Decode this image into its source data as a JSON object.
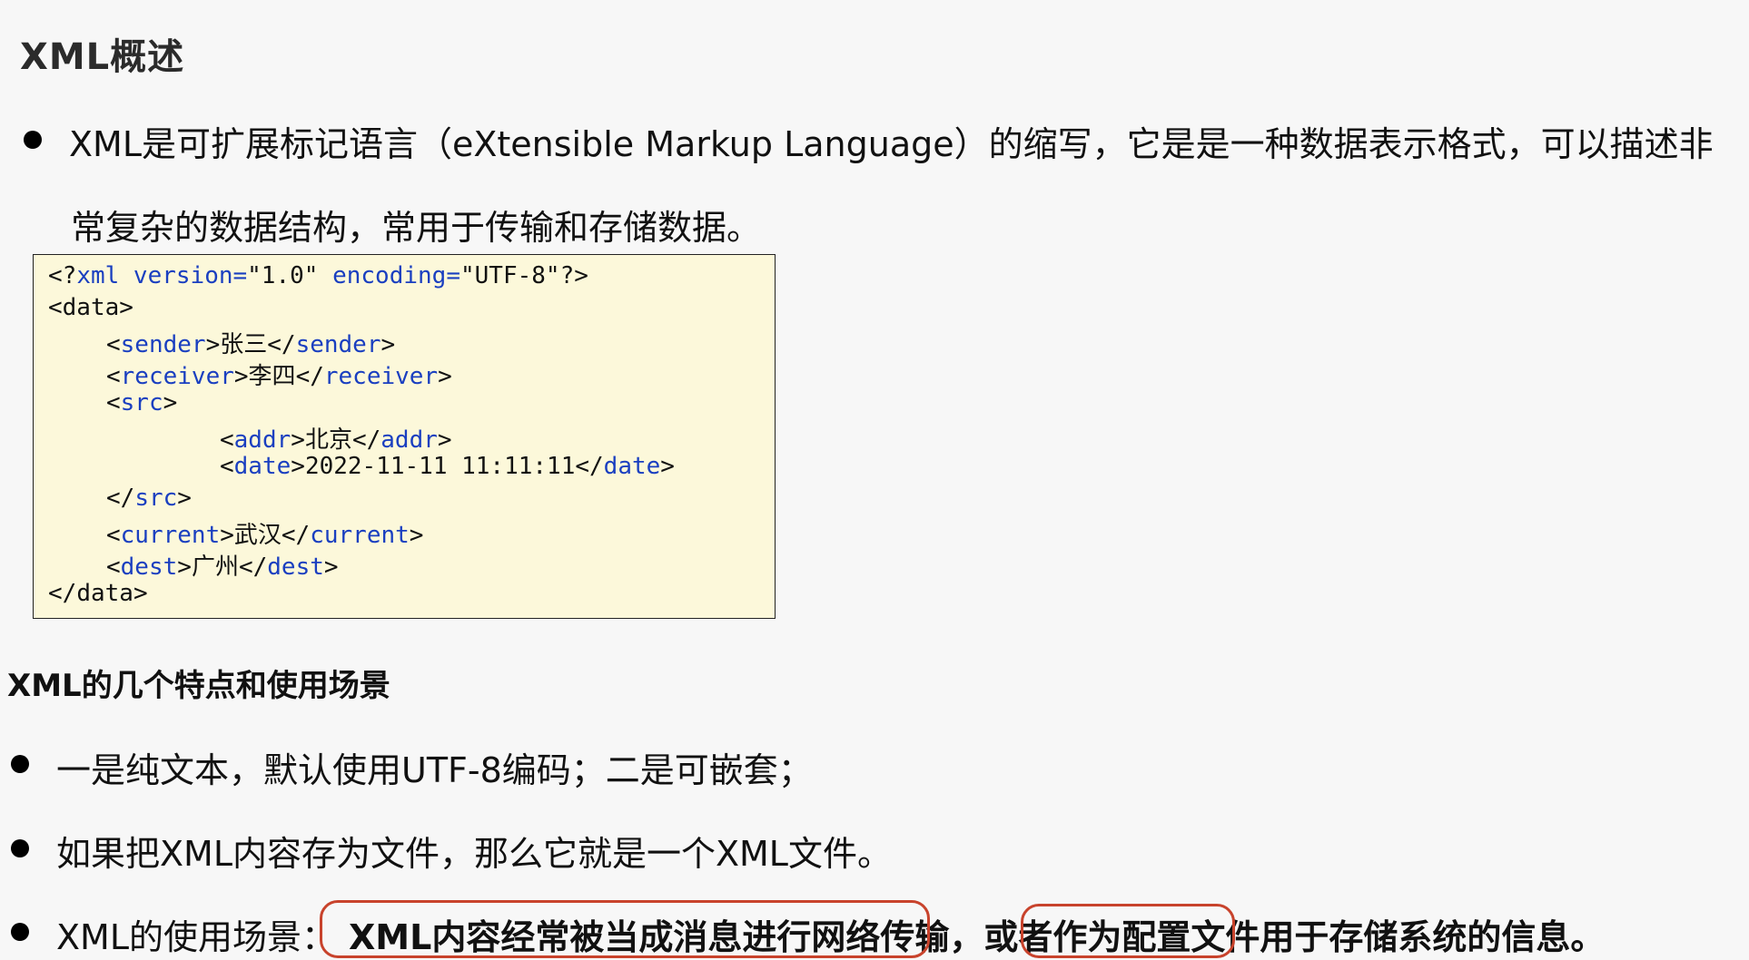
{
  "title": "XML概述",
  "intro": {
    "line1": "XML是可扩展标记语言（eXtensible Markup Language）的缩写，它是是一种数据表示格式，可以描述非",
    "line2": "常复杂的数据结构，常用于传输和存储数据。"
  },
  "code": {
    "l1_open": "<?",
    "l1_xml": "xml version=",
    "l1_v": "\"1.0\"",
    "l1_enc": " encoding=",
    "l1_encv": "\"UTF-8\"",
    "l1_close": "?>",
    "data_open_a": "<",
    "data_open_tag": "data",
    "data_open_b": ">",
    "sender_tag": "sender",
    "sender_val": "张三",
    "receiver_tag": "receiver",
    "receiver_val": "李四",
    "src_tag": "src",
    "addr_tag": "addr",
    "addr_val": "北京",
    "date_tag": "date",
    "date_val": "2022-11-11 11:11:11",
    "current_tag": "current",
    "current_val": "武汉",
    "dest_tag": "dest",
    "dest_val": "广州",
    "data_tag": "data"
  },
  "subtitle": "XML的几个特点和使用场景",
  "points": {
    "p1": "一是纯文本，默认使用UTF-8编码；二是可嵌套；",
    "p2": "如果把XML内容存为文件，那么它就是一个XML文件。",
    "p3_prefix": "XML的使用场景：",
    "p3_bold1": "XML内容经常被当成消息进行网络传输",
    "p3_mid": "，或者",
    "p3_bold2": "作为配置文件",
    "p3_suffix": "用于存储系统的信息。"
  },
  "colors": {
    "tag": "#1a3fc0",
    "code_bg": "#fcf8da",
    "highlight_circle": "#c8432c"
  }
}
